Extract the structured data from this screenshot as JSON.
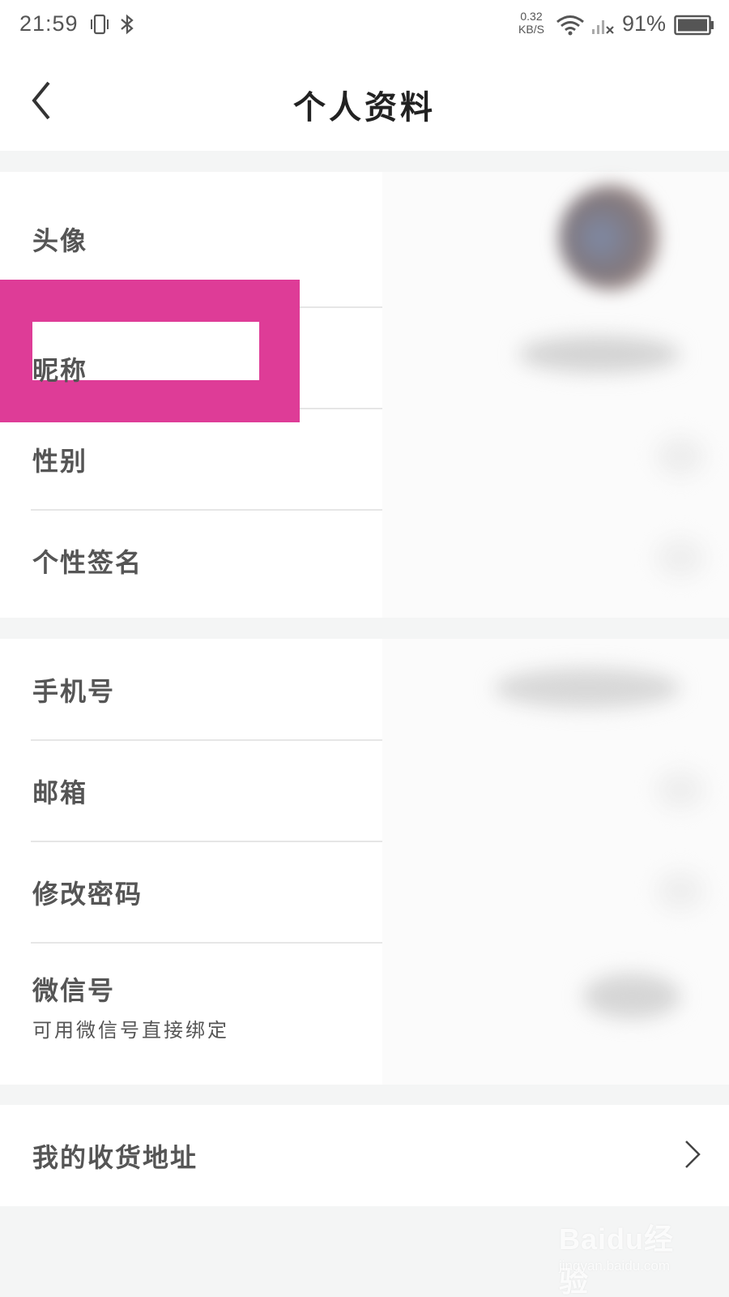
{
  "status_bar": {
    "time": "21:59",
    "network_speed_value": "0.32",
    "network_speed_unit": "KB/S",
    "battery": "91%",
    "icons": [
      "vibrate-icon",
      "bluetooth-icon",
      "wifi-icon",
      "signal-icon",
      "battery-icon"
    ]
  },
  "header": {
    "title": "个人资料",
    "back_icon": "chevron-left-icon"
  },
  "profile_group": {
    "items": [
      {
        "label": "头像"
      },
      {
        "label": "昵称"
      },
      {
        "label": "性别"
      },
      {
        "label": "个性签名"
      }
    ]
  },
  "account_group": {
    "items": [
      {
        "label": "手机号"
      },
      {
        "label": "邮箱"
      },
      {
        "label": "修改密码"
      },
      {
        "label": "微信号",
        "sublabel": "可用微信号直接绑定"
      }
    ]
  },
  "address_group": {
    "items": [
      {
        "label": "我的收货地址",
        "icon": "chevron-right-icon"
      }
    ]
  },
  "highlight_color": "#de3c97",
  "watermark": {
    "logo": "Baidu经验",
    "url": "jingyan.baidu.com"
  }
}
